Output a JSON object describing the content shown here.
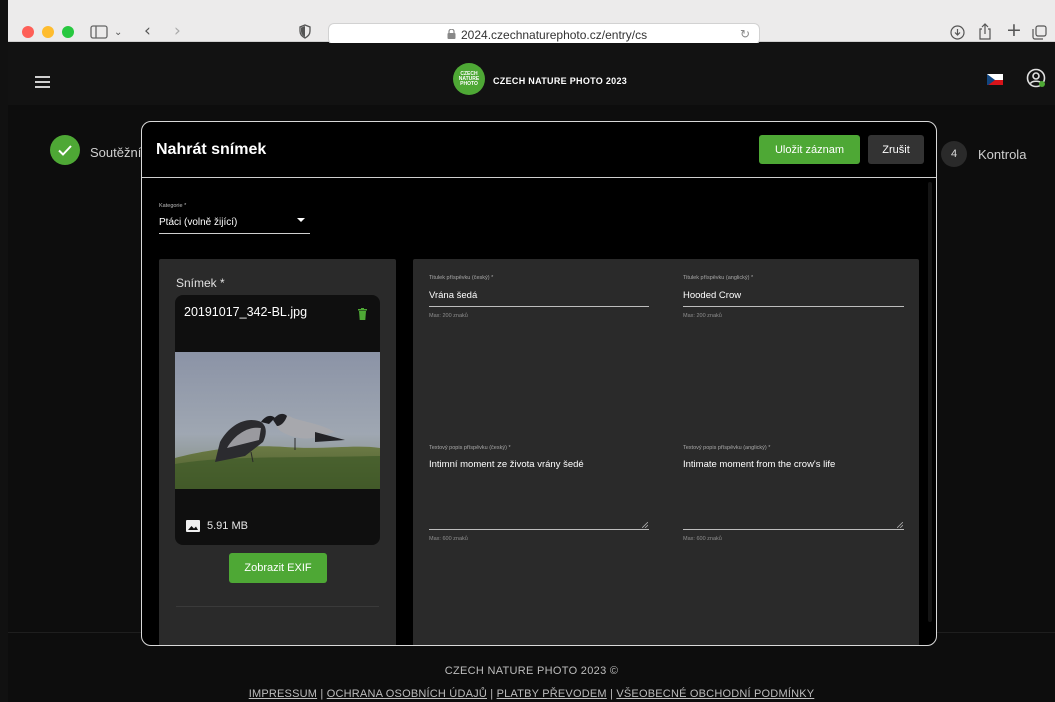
{
  "browser": {
    "url": "2024.czechnaturephoto.cz/entry/cs"
  },
  "site": {
    "logo_lines": [
      "CZECH",
      "NATURE",
      "PHOTO"
    ],
    "name": "CZECH NATURE PHOTO 2023"
  },
  "stepper": {
    "step1_label": "Soutěžní",
    "step4_number": "4",
    "step4_label": "Kontrola"
  },
  "dialog": {
    "title": "Nahrát snímek",
    "save_label": "Uložit záznam",
    "cancel_label": "Zrušit",
    "category": {
      "label": "Kategorie *",
      "value": "Ptáci (volně žijící)"
    },
    "image": {
      "label": "Snímek *",
      "file_name": "20191017_342-BL.jpg",
      "file_size": "5.91 MB",
      "exif_label": "Zobrazit EXIF"
    },
    "fields": {
      "title_cs": {
        "label": "Titulek příspěvku (český) *",
        "value": "Vrána šedá",
        "hint": "Max: 200 znaků"
      },
      "title_en": {
        "label": "Titulek příspěvku (anglický) *",
        "value": "Hooded Crow",
        "hint": "Max: 200 znaků"
      },
      "desc_cs": {
        "label": "Textový popis příspěvku (český) *",
        "value": "Intimní moment ze života vrány šedé",
        "hint": "Max: 600 znaků"
      },
      "desc_en": {
        "label": "Textový popis příspěvku (anglický) *",
        "value": "Intimate moment from the crow's life",
        "hint": "Max: 600 znaků"
      }
    }
  },
  "footer": {
    "title": "CZECH NATURE PHOTO 2023 ©",
    "links": [
      "IMPRESSUM",
      "OCHRANA OSOBNÍCH ÚDAJŮ",
      "PLATBY PŘEVODEM",
      "VŠEOBECNÉ OBCHODNÍ PODMÍNKY"
    ],
    "separator": "|"
  },
  "colors": {
    "accent": "#4ea835",
    "background": "#0d0d0d",
    "card": "#2a2a2a"
  }
}
